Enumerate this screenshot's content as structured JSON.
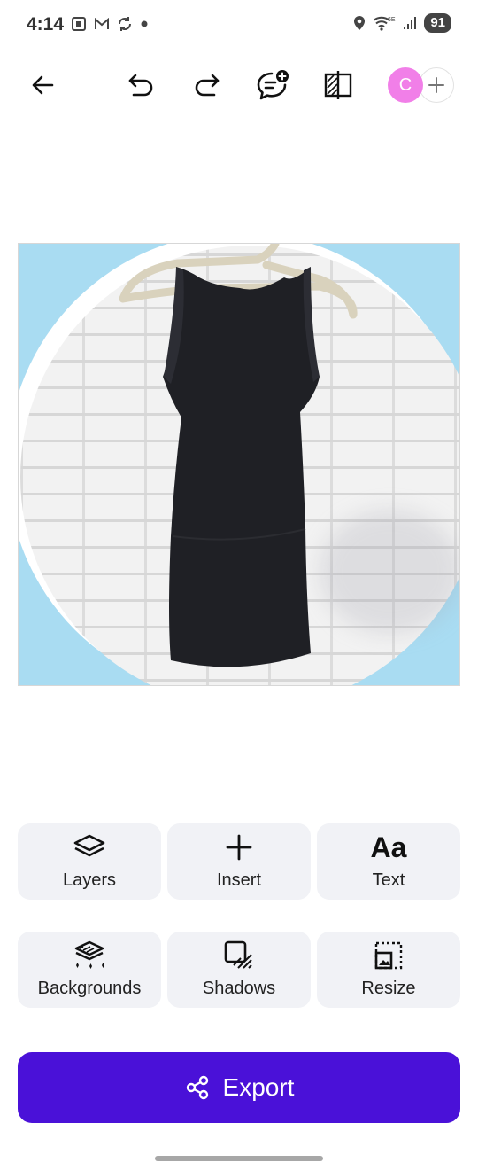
{
  "status_bar": {
    "time": "4:14",
    "notification_icons": [
      "screenshot-icon",
      "gmail-icon",
      "sync-icon",
      "dot-icon"
    ],
    "system_icons": [
      "location-icon",
      "wifi-6e-icon",
      "signal-icon"
    ],
    "wifi_badge": "6E",
    "battery": "91"
  },
  "toolbar": {
    "back_icon": "arrow-left-icon",
    "undo_icon": "undo-icon",
    "redo_icon": "redo-icon",
    "comment_icon": "comment-add-icon",
    "compare_icon": "compare-icon",
    "avatar_initial": "C",
    "avatar_color": "#f17fe8",
    "add_collaborator_icon": "plus-icon"
  },
  "canvas": {
    "background_color": "#a9dcf2",
    "content": "photo-of-black-tank-top-on-hanger"
  },
  "actions": [
    {
      "label": "Layers",
      "icon": "layers-icon"
    },
    {
      "label": "Insert",
      "icon": "plus-icon"
    },
    {
      "label": "Text",
      "icon": "text-aa-icon",
      "icon_text": "Aa"
    },
    {
      "label": "Backgrounds",
      "icon": "backgrounds-icon"
    },
    {
      "label": "Shadows",
      "icon": "shadows-icon"
    },
    {
      "label": "Resize",
      "icon": "resize-icon"
    }
  ],
  "export": {
    "label": "Export",
    "icon": "share-icon",
    "color": "#4a11d8"
  }
}
